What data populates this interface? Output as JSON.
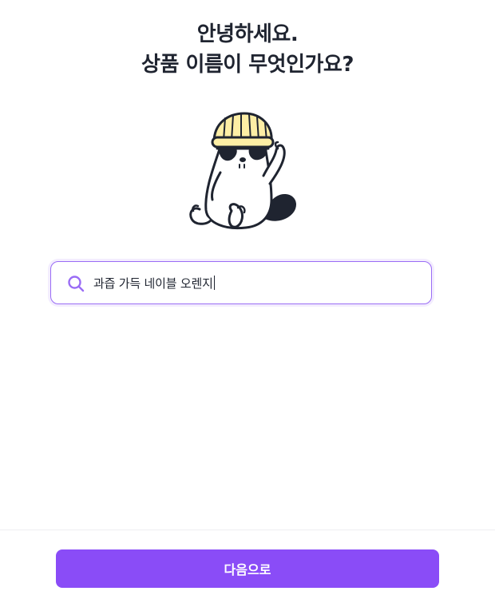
{
  "header": {
    "line1": "안녕하세요.",
    "line2": "상품 이름이 무엇인가요?"
  },
  "mascot": {
    "icon": "beaver-with-beanie-and-sunglasses-icon",
    "hat_color": "#fdeea5"
  },
  "search": {
    "icon": "search-icon",
    "value": "과즙 가득 네이블 오렌지",
    "accent_color": "#9a6cf5"
  },
  "footer": {
    "next_label": "다음으로",
    "button_color": "#8a4cf7"
  }
}
